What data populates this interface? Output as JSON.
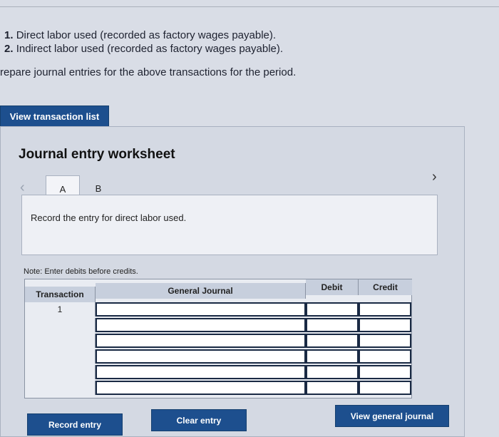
{
  "questions": [
    {
      "num": "1.",
      "text": "Direct labor used (recorded as factory wages payable)."
    },
    {
      "num": "2.",
      "text": "Indirect labor used (recorded as factory wages payable)."
    }
  ],
  "instruction": "repare journal entries for the above transactions for the period.",
  "view_transaction_button": "View transaction list",
  "worksheet": {
    "title": "Journal entry worksheet",
    "tabs": [
      "A",
      "B"
    ],
    "entry_text": "Record the entry for direct labor used.",
    "note": "Note: Enter debits before credits.",
    "headers": {
      "transaction": "Transaction",
      "journal": "General Journal",
      "debit": "Debit",
      "credit": "Credit"
    },
    "rows": [
      {
        "transaction": "1"
      },
      {
        "transaction": ""
      },
      {
        "transaction": ""
      },
      {
        "transaction": ""
      },
      {
        "transaction": ""
      },
      {
        "transaction": ""
      }
    ]
  },
  "buttons": {
    "record": "Record entry",
    "clear": "Clear entry",
    "view_journal": "View general journal"
  },
  "icons": {
    "prev": "chevron-left-icon",
    "next": "chevron-right-icon"
  },
  "colors": {
    "button": "#1d4f8e",
    "header": "#c7cfdd"
  }
}
